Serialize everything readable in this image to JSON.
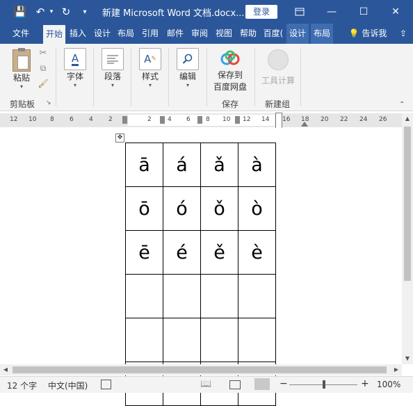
{
  "window": {
    "title": "新建 Microsoft Word 文档.docx...",
    "login_label": "登录",
    "minimize": "—",
    "maximize": "☐",
    "close": "✕"
  },
  "quick_access": {
    "save": "💾",
    "undo": "↶",
    "redo": "↻",
    "more": "▾"
  },
  "tabs": [
    {
      "label": "文件"
    },
    {
      "label": "开始"
    },
    {
      "label": "插入"
    },
    {
      "label": "设计"
    },
    {
      "label": "布局"
    },
    {
      "label": "引用"
    },
    {
      "label": "邮件"
    },
    {
      "label": "审阅"
    },
    {
      "label": "视图"
    },
    {
      "label": "帮助"
    },
    {
      "label": "百度("
    },
    {
      "label": "设计"
    },
    {
      "label": "布局"
    }
  ],
  "tell_me": "告诉我",
  "share": "⇪",
  "ribbon": {
    "paste": "粘贴",
    "font": "字体",
    "paragraph": "段落",
    "styles": "样式",
    "editing": "编辑",
    "save_baidu_line1": "保存到",
    "save_baidu_line2": "百度网盘",
    "tool_calc": "工具计算",
    "group_clipboard": "剪贴板",
    "group_save": "保存",
    "group_new": "新建组"
  },
  "ruler_numbers": [
    "12",
    "10",
    "8",
    "6",
    "4",
    "2",
    "2",
    "4",
    "6",
    "8",
    "10",
    "12",
    "14",
    "16",
    "18",
    "20",
    "22",
    "24",
    "26"
  ],
  "table": {
    "rows": [
      [
        "ā",
        "á",
        "ǎ",
        "à"
      ],
      [
        "ō",
        "ó",
        "ǒ",
        "ò"
      ],
      [
        "ē",
        "é",
        "ě",
        "è"
      ],
      [
        "",
        "",
        "",
        ""
      ],
      [
        "",
        "",
        "",
        ""
      ],
      [
        "",
        "",
        "",
        ""
      ]
    ]
  },
  "status": {
    "word_count": "12 个字",
    "language": "中文(中国)",
    "zoom": "100%",
    "zoom_minus": "−",
    "zoom_plus": "+"
  },
  "colors": {
    "accent": "#2b579a",
    "ribbon_bg": "#f3f3f3"
  }
}
